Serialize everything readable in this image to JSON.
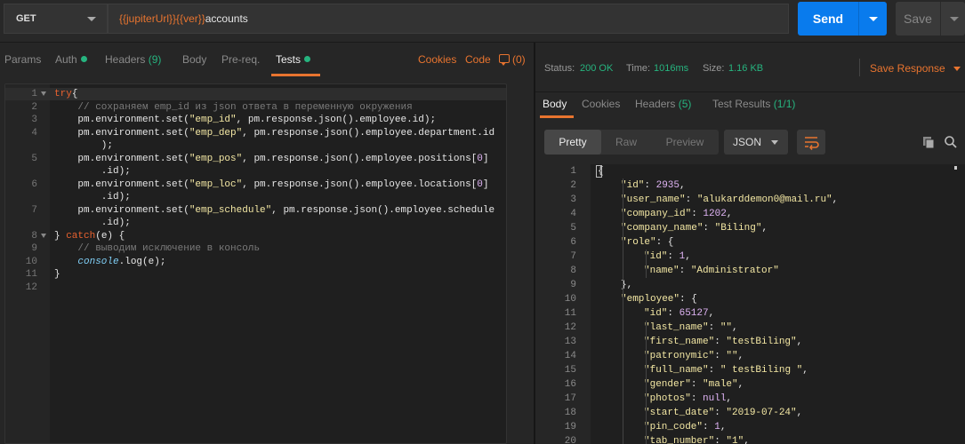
{
  "request": {
    "method": "GET",
    "url_parts": [
      {
        "text": "{{jupiterUrl}}",
        "kind": "var"
      },
      {
        "text": "{{ver}}",
        "kind": "var"
      },
      {
        "text": "accounts",
        "kind": "plain"
      }
    ],
    "send_label": "Send",
    "save_label": "Save"
  },
  "request_tabs": [
    {
      "label": "Params"
    },
    {
      "label": "Auth"
    },
    {
      "label": "Headers",
      "count": "(9)"
    },
    {
      "label": "Body"
    },
    {
      "label": "Pre-req."
    },
    {
      "label": "Tests"
    }
  ],
  "request_links": {
    "cookies": "Cookies",
    "code": "Code",
    "comments": "(0)"
  },
  "editor_lines": [
    {
      "n": "1",
      "fold": true,
      "active": true,
      "tokens": [
        [
          "kw",
          "try"
        ],
        [
          "",
          "{"
        ]
      ]
    },
    {
      "n": "2",
      "tokens": [
        [
          "",
          "    "
        ],
        [
          "cm",
          "// сохраняем emp_id из json ответа в переменную окружения"
        ]
      ]
    },
    {
      "n": "3",
      "tokens": [
        [
          "",
          "    pm.environment.set("
        ],
        [
          "str",
          "\"emp_id\""
        ],
        [
          "",
          ", pm.response.json().employee.id);"
        ]
      ]
    },
    {
      "n": "4",
      "tokens": [
        [
          "",
          "    pm.environment.set("
        ],
        [
          "str",
          "\"emp_dep\""
        ],
        [
          "",
          ", pm.response.json().employee.department.id"
        ]
      ]
    },
    {
      "n": "",
      "tokens": [
        [
          "",
          "        );"
        ]
      ]
    },
    {
      "n": "5",
      "tokens": [
        [
          "",
          "    pm.environment.set("
        ],
        [
          "str",
          "\"emp_pos\""
        ],
        [
          "",
          ", pm.response.json().employee.positions["
        ],
        [
          "num",
          "0"
        ],
        [
          "",
          "]"
        ]
      ]
    },
    {
      "n": "",
      "tokens": [
        [
          "",
          "        .id);"
        ]
      ]
    },
    {
      "n": "6",
      "tokens": [
        [
          "",
          "    pm.environment.set("
        ],
        [
          "str",
          "\"emp_loc\""
        ],
        [
          "",
          ", pm.response.json().employee.locations["
        ],
        [
          "num",
          "0"
        ],
        [
          "",
          "]"
        ]
      ]
    },
    {
      "n": "",
      "tokens": [
        [
          "",
          "        .id);"
        ]
      ]
    },
    {
      "n": "7",
      "tokens": [
        [
          "",
          "    pm.environment.set("
        ],
        [
          "str",
          "\"emp_schedule\""
        ],
        [
          "",
          ", pm.response.json().employee.schedule"
        ]
      ]
    },
    {
      "n": "",
      "tokens": [
        [
          "",
          "        .id);"
        ]
      ]
    },
    {
      "n": "8",
      "fold": true,
      "tokens": [
        [
          "",
          "} "
        ],
        [
          "kw",
          "catch"
        ],
        [
          "",
          "(e) {"
        ]
      ]
    },
    {
      "n": "9",
      "tokens": [
        [
          "",
          "    "
        ],
        [
          "cm",
          "// выводим исключение в консоль"
        ]
      ]
    },
    {
      "n": "10",
      "tokens": [
        [
          "",
          "    "
        ],
        [
          "it",
          "console"
        ],
        [
          "",
          ".log(e);"
        ]
      ]
    },
    {
      "n": "11",
      "tokens": [
        [
          "",
          "}"
        ]
      ]
    },
    {
      "n": "12",
      "tokens": [
        [
          "",
          ""
        ]
      ]
    }
  ],
  "response_status": {
    "status_label": "Status:",
    "status_value": "200 OK",
    "time_label": "Time:",
    "time_value": "1016ms",
    "size_label": "Size:",
    "size_value": "1.16 KB",
    "save_response": "Save Response"
  },
  "response_tabs": [
    {
      "label": "Body"
    },
    {
      "label": "Cookies"
    },
    {
      "label": "Headers",
      "count": "(5)"
    },
    {
      "label": "Test Results",
      "count": "(1/1)"
    }
  ],
  "view_modes": {
    "pretty": "Pretty",
    "raw": "Raw",
    "preview": "Preview",
    "format": "JSON"
  },
  "json_lines": [
    {
      "n": "1",
      "indent": 0,
      "tokens": [
        [
          "",
          "{"
        ]
      ]
    },
    {
      "n": "2",
      "indent": 1,
      "tokens": [
        [
          "key",
          "\"id\""
        ],
        [
          "",
          ": "
        ],
        [
          "num",
          "2935"
        ],
        [
          "",
          ","
        ]
      ]
    },
    {
      "n": "3",
      "indent": 1,
      "tokens": [
        [
          "key",
          "\"user_name\""
        ],
        [
          "",
          ": "
        ],
        [
          "str",
          "\"alukarddemon0@mail.ru\""
        ],
        [
          "",
          ","
        ]
      ]
    },
    {
      "n": "4",
      "indent": 1,
      "tokens": [
        [
          "key",
          "\"company_id\""
        ],
        [
          "",
          ": "
        ],
        [
          "num",
          "1202"
        ],
        [
          "",
          ","
        ]
      ]
    },
    {
      "n": "5",
      "indent": 1,
      "tokens": [
        [
          "key",
          "\"company_name\""
        ],
        [
          "",
          ": "
        ],
        [
          "str",
          "\"Biling\""
        ],
        [
          "",
          ","
        ]
      ]
    },
    {
      "n": "6",
      "indent": 1,
      "tokens": [
        [
          "key",
          "\"role\""
        ],
        [
          "",
          ": {"
        ]
      ]
    },
    {
      "n": "7",
      "indent": 2,
      "tokens": [
        [
          "key",
          "\"id\""
        ],
        [
          "",
          ": "
        ],
        [
          "num",
          "1"
        ],
        [
          "",
          ","
        ]
      ]
    },
    {
      "n": "8",
      "indent": 2,
      "tokens": [
        [
          "key",
          "\"name\""
        ],
        [
          "",
          ": "
        ],
        [
          "str",
          "\"Administrator\""
        ]
      ]
    },
    {
      "n": "9",
      "indent": 1,
      "tokens": [
        [
          "",
          "},"
        ]
      ]
    },
    {
      "n": "10",
      "indent": 1,
      "tokens": [
        [
          "key",
          "\"employee\""
        ],
        [
          "",
          ": {"
        ]
      ]
    },
    {
      "n": "11",
      "indent": 2,
      "tokens": [
        [
          "key",
          "\"id\""
        ],
        [
          "",
          ": "
        ],
        [
          "num",
          "65127"
        ],
        [
          "",
          ","
        ]
      ]
    },
    {
      "n": "12",
      "indent": 2,
      "tokens": [
        [
          "key",
          "\"last_name\""
        ],
        [
          "",
          ": "
        ],
        [
          "str",
          "\"\""
        ],
        [
          "",
          ","
        ]
      ]
    },
    {
      "n": "13",
      "indent": 2,
      "tokens": [
        [
          "key",
          "\"first_name\""
        ],
        [
          "",
          ": "
        ],
        [
          "str",
          "\"testBiling\""
        ],
        [
          "",
          ","
        ]
      ]
    },
    {
      "n": "14",
      "indent": 2,
      "tokens": [
        [
          "key",
          "\"patronymic\""
        ],
        [
          "",
          ": "
        ],
        [
          "str",
          "\"\""
        ],
        [
          "",
          ","
        ]
      ]
    },
    {
      "n": "15",
      "indent": 2,
      "tokens": [
        [
          "key",
          "\"full_name\""
        ],
        [
          "",
          ": "
        ],
        [
          "str",
          "\" testBiling \""
        ],
        [
          "",
          ","
        ]
      ]
    },
    {
      "n": "16",
      "indent": 2,
      "tokens": [
        [
          "key",
          "\"gender\""
        ],
        [
          "",
          ": "
        ],
        [
          "str",
          "\"male\""
        ],
        [
          "",
          ","
        ]
      ]
    },
    {
      "n": "17",
      "indent": 2,
      "tokens": [
        [
          "key",
          "\"photos\""
        ],
        [
          "",
          ": "
        ],
        [
          "null",
          "null"
        ],
        [
          "",
          ","
        ]
      ]
    },
    {
      "n": "18",
      "indent": 2,
      "tokens": [
        [
          "key",
          "\"start_date\""
        ],
        [
          "",
          ": "
        ],
        [
          "str",
          "\"2019-07-24\""
        ],
        [
          "",
          ","
        ]
      ]
    },
    {
      "n": "19",
      "indent": 2,
      "tokens": [
        [
          "key",
          "\"pin_code\""
        ],
        [
          "",
          ": "
        ],
        [
          "num",
          "1"
        ],
        [
          "",
          ","
        ]
      ]
    },
    {
      "n": "20",
      "indent": 2,
      "tokens": [
        [
          "key",
          "\"tab_number\""
        ],
        [
          "",
          ": "
        ],
        [
          "str",
          "\"1\""
        ],
        [
          "",
          ","
        ]
      ]
    }
  ]
}
